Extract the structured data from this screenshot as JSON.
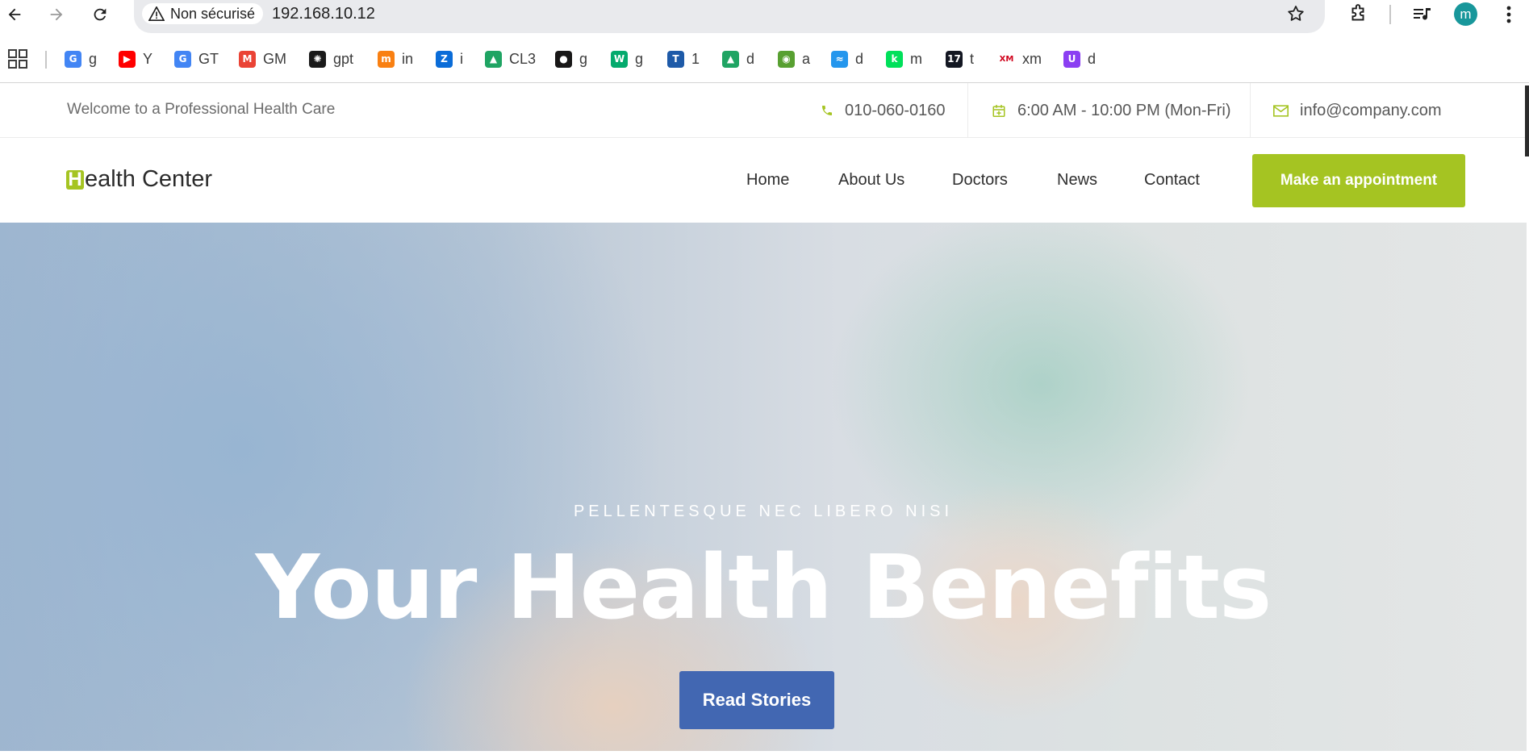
{
  "browser": {
    "security_label": "Non sécurisé",
    "url": "192.168.10.12",
    "profile_initial": "m"
  },
  "bookmarks": [
    {
      "label": "g",
      "icon": "google-icon",
      "color": "#4285f4",
      "glyph": "G"
    },
    {
      "label": "Y",
      "icon": "youtube-icon",
      "color": "#ff0000",
      "glyph": "▶"
    },
    {
      "label": "GT",
      "icon": "google-translate-icon",
      "color": "#4285f4",
      "glyph": "G"
    },
    {
      "label": "GM",
      "icon": "gmail-icon",
      "color": "#ea4335",
      "glyph": "M"
    },
    {
      "label": "gpt",
      "icon": "openai-icon",
      "color": "#1a1a1a",
      "glyph": "✺"
    },
    {
      "label": "in",
      "icon": "moodle-icon",
      "color": "#f98012",
      "glyph": "m"
    },
    {
      "label": "i",
      "icon": "zalo-icon",
      "color": "#0a6cd8",
      "glyph": "Z"
    },
    {
      "label": "CL3",
      "icon": "google-drive-icon",
      "color": "#1fa463",
      "glyph": "▲"
    },
    {
      "label": "g",
      "icon": "github-icon",
      "color": "#181717",
      "glyph": "●"
    },
    {
      "label": "g",
      "icon": "w3schools-icon",
      "color": "#04aa6d",
      "glyph": "W"
    },
    {
      "label": "1",
      "icon": "tuk-tuk-icon",
      "color": "#1e5aa8",
      "glyph": "T"
    },
    {
      "label": "d",
      "icon": "google-drive-icon",
      "color": "#1fa463",
      "glyph": "▲"
    },
    {
      "label": "a",
      "icon": "owl-icon",
      "color": "#58a031",
      "glyph": "◉"
    },
    {
      "label": "d",
      "icon": "docker-icon",
      "color": "#2496ed",
      "glyph": "≈"
    },
    {
      "label": "m",
      "icon": "deepnote-icon",
      "color": "#00e05a",
      "glyph": "k"
    },
    {
      "label": "t",
      "icon": "tradingview-icon",
      "color": "#131722",
      "glyph": "17"
    },
    {
      "label": "xm",
      "icon": "xm-icon",
      "color": "#ffffff",
      "glyph": "XM"
    },
    {
      "label": "d",
      "icon": "purple-circle-icon",
      "color": "#8b3ff2",
      "glyph": "U"
    }
  ],
  "site": {
    "welcome": "Welcome to a Professional Health Care",
    "phone": "010-060-0160",
    "hours": "6:00 AM - 10:00 PM (Mon-Fri)",
    "email": "info@company.com",
    "logo_letter": "H",
    "logo_rest": "ealth Center",
    "menu": [
      "Home",
      "About Us",
      "Doctors",
      "News",
      "Contact"
    ],
    "cta": "Make an appointment",
    "accent_color": "#a5c422",
    "hero": {
      "subtitle": "PELLENTESQUE NEC LIBERO NISI",
      "title": "Your Health Benefits",
      "button": "Read Stories",
      "button_color": "#4267b2"
    }
  }
}
